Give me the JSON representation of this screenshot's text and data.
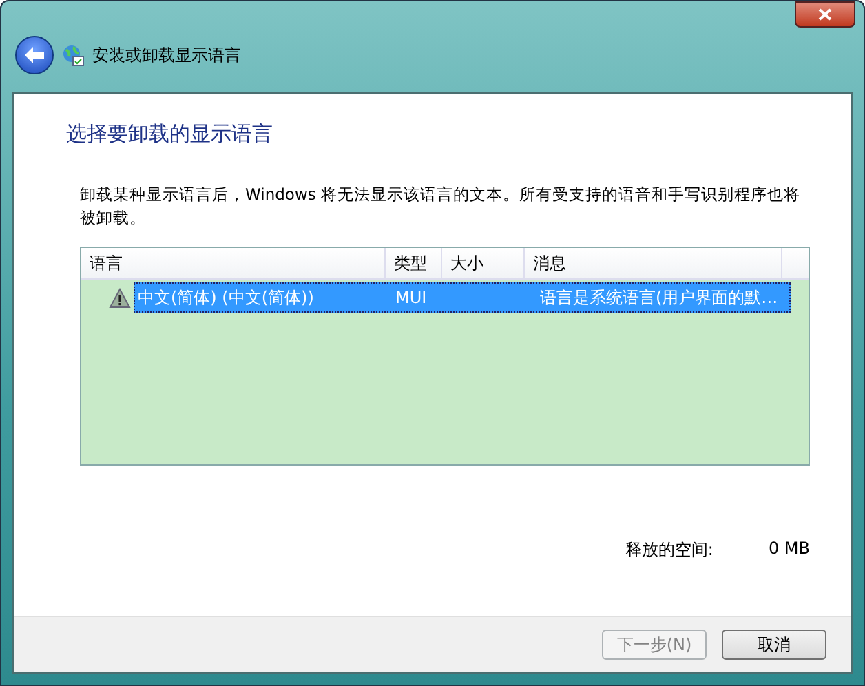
{
  "window": {
    "title": "安装或卸载显示语言"
  },
  "heading": "选择要卸载的显示语言",
  "description": "卸载某种显示语言后，Windows 将无法显示该语言的文本。所有受支持的语音和手写识别程序也将被卸载。",
  "table": {
    "columns": [
      "语言",
      "类型",
      "大小",
      "消息"
    ],
    "rows": [
      {
        "cells": [
          "中文(简体) (中文(简体))",
          "MUI",
          "",
          "语言是系统语言(用户界面的默…"
        ],
        "selected": true,
        "kind": "warning"
      }
    ]
  },
  "freed_space": {
    "label": "释放的空间:",
    "value": "0 MB"
  },
  "buttons": [
    {
      "label": "下一步(N)",
      "disabled": true
    },
    {
      "label": "取消",
      "disabled": false
    }
  ]
}
